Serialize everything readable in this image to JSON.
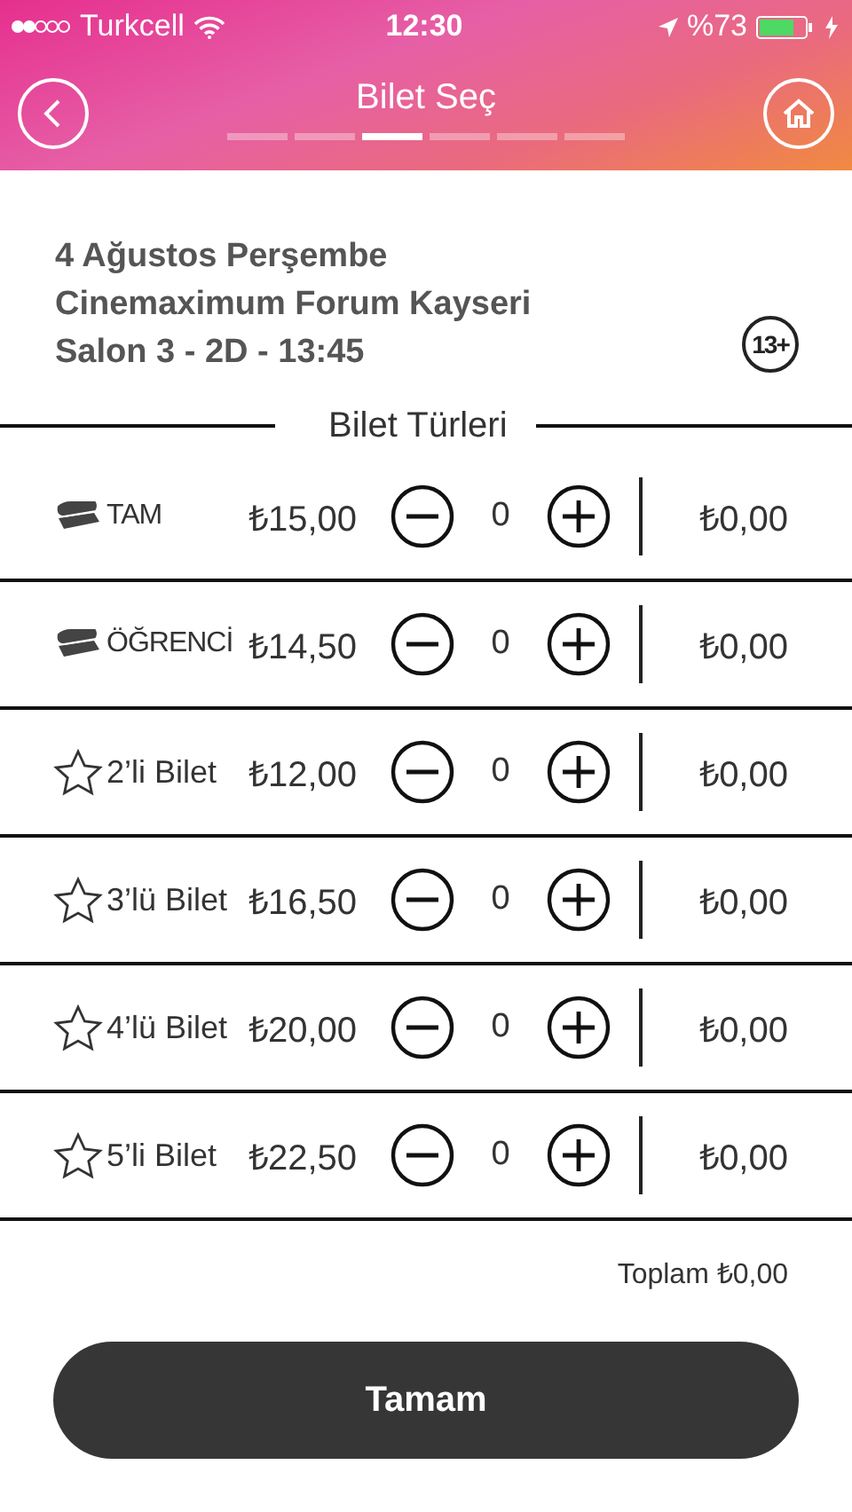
{
  "status_bar": {
    "carrier": "Turkcell",
    "time": "12:30",
    "battery": "%73"
  },
  "header": {
    "title": "Bilet Seç",
    "steps": [
      {
        "selected": false
      },
      {
        "selected": false
      },
      {
        "selected": true
      },
      {
        "selected": false
      },
      {
        "selected": false
      },
      {
        "selected": false
      }
    ]
  },
  "session": {
    "lines": [
      "4 Ağustos Perşembe",
      "Cinemaximum Forum Kayseri",
      "Salon 3 - 2D  - 13:45"
    ],
    "rating": "13+"
  },
  "section_title": "Bilet Türleri",
  "tickets": [
    {
      "kind": "ticket",
      "name": "TAM",
      "price": "₺15,00",
      "count": "0",
      "total": "₺0,00"
    },
    {
      "kind": "ticket",
      "name": "ÖĞRENCİ",
      "price": "₺14,50",
      "count": "0",
      "total": "₺0,00"
    },
    {
      "kind": "star",
      "name": "2’li Bilet",
      "price": "₺12,00",
      "count": "0",
      "total": "₺0,00"
    },
    {
      "kind": "star",
      "name": "3’lü Bilet",
      "price": "₺16,50",
      "count": "0",
      "total": "₺0,00"
    },
    {
      "kind": "star",
      "name": "4’lü Bilet",
      "price": "₺20,00",
      "count": "0",
      "total": "₺0,00"
    },
    {
      "kind": "star",
      "name": "5’li Bilet",
      "price": "₺22,50",
      "count": "0",
      "total": "₺0,00"
    }
  ],
  "total": "Toplam ₺0,00",
  "button": "Tamam"
}
